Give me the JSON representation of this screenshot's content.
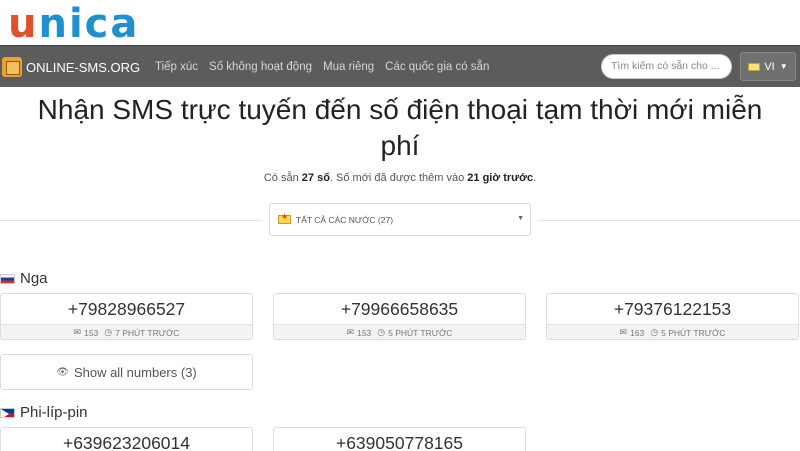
{
  "brand": {
    "logo_text_u": "u",
    "logo_text_rest": "nica"
  },
  "navbar": {
    "site_name": "ONLINE-SMS.ORG",
    "links": [
      "Tiếp xúc",
      "Số không hoạt động",
      "Mua riêng",
      "Các quốc gia có sẵn"
    ],
    "search_placeholder": "Tìm kiếm có sẵn cho ...",
    "language": "VI"
  },
  "page": {
    "title": "Nhận SMS trực tuyến đến số điện thoại tạm thời mới miễn phí",
    "subtitle_prefix": "Có sẵn",
    "subtitle_count": "27 số",
    "subtitle_middle": ". Số mới đã được thêm vào",
    "subtitle_time": "21 giờ trước",
    "subtitle_suffix": "."
  },
  "filter": {
    "selected": "TẤT CẢ CÁC NƯỚC (27)"
  },
  "countries": [
    {
      "name": "Nga",
      "numbers": [
        {
          "number": "+79828966527",
          "messages": "153",
          "time": "7 PHÚT TRƯỚC"
        },
        {
          "number": "+79966658635",
          "messages": "153",
          "time": "5 PHÚT TRƯỚC"
        },
        {
          "number": "+79376122153",
          "messages": "163",
          "time": "5 PHÚT TRƯỚC"
        }
      ],
      "show_all": "Show all numbers (3)"
    },
    {
      "name": "Phi-líp-pin",
      "numbers": [
        {
          "number": "+639623206014"
        },
        {
          "number": "+639050778165"
        }
      ]
    }
  ],
  "icons": {
    "mail": "envelope-icon",
    "clock": "clock-icon",
    "eye": "eye-icon"
  }
}
